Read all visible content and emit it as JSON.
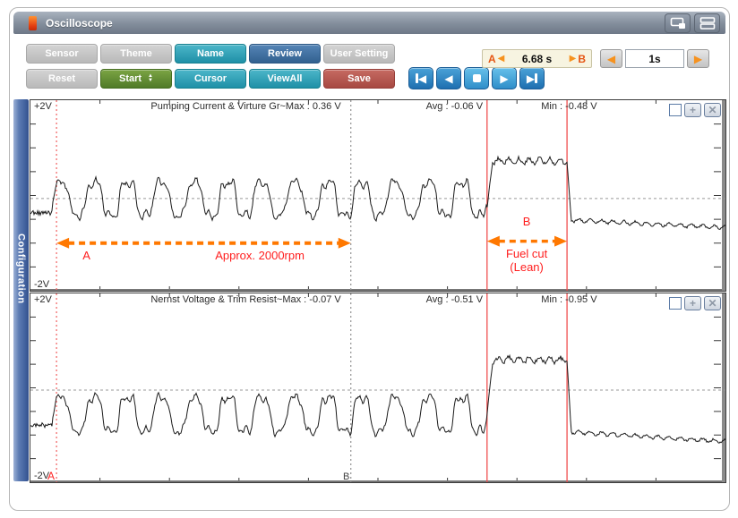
{
  "window": {
    "title": "Oscilloscope",
    "controls": [
      "cascade",
      "tile"
    ]
  },
  "toolbar": {
    "row1": [
      {
        "label": "Sensor"
      },
      {
        "label": "Theme"
      },
      {
        "label": "Name"
      },
      {
        "label": "Review"
      },
      {
        "label": "User Setting"
      }
    ],
    "row2": [
      {
        "label": "Reset"
      },
      {
        "label": "Start"
      },
      {
        "label": "Cursor"
      },
      {
        "label": "ViewAll"
      },
      {
        "label": "Save"
      }
    ],
    "ab_range": {
      "a": "A",
      "value": "6.68 s",
      "b": "B"
    },
    "timebase": {
      "value": "1s"
    },
    "transport": [
      "skip-start",
      "step-back",
      "stop",
      "play",
      "skip-end"
    ]
  },
  "sidebar": {
    "label": "Configuration"
  },
  "cursors": {
    "a_frac": 0.0375,
    "b_frac": 0.461,
    "r1_frac": 0.657,
    "r2_frac": 0.772,
    "a_label": "A",
    "b_label": "B"
  },
  "charts": [
    {
      "v_top": "+2V",
      "v_bottom": "-2V",
      "title": "Pumping Current & Virture Gr~Max : 0.36 V",
      "avg": "Avg : -0.06 V",
      "min": "Min : -0.48 V",
      "annotations": {
        "a": "A",
        "rpm": "Approx. 2000rpm",
        "b": "B",
        "fuel_line1": "Fuel cut",
        "fuel_line2": "(Lean)"
      },
      "wave": {
        "center": 0.516,
        "osc_start": 0.032,
        "osc_top": -0.082,
        "osc_bottom": 0.088,
        "cycles": 13,
        "plateau": -0.197,
        "tail_start": 0.112,
        "tail_end": 0.152
      },
      "arrows": [
        {
          "x1": 0.0375,
          "x2": 0.461,
          "y": 0.75,
          "w": 4
        },
        {
          "x1": 0.657,
          "x2": 0.772,
          "y": 0.74,
          "w": 3.5
        }
      ]
    },
    {
      "v_top": "+2V",
      "v_bottom": "-2V",
      "title": "Nernst Voltage & Trim Resist~Max : -0.07 V",
      "avg": "Avg : -0.51 V",
      "min": "Min : -0.95 V",
      "wave": {
        "center": 0.512,
        "osc_start": 0.032,
        "osc_top": 0.042,
        "osc_bottom": 0.218,
        "cycles": 13,
        "plateau": -0.161,
        "tail_start": 0.22,
        "tail_end": 0.272
      }
    }
  ],
  "colors": {
    "annotation_red": "#ff1e1e",
    "arrow_orange": "#ff7800",
    "cursor_red_dashed": "#f26b6b",
    "cursor_gray_dashed": "#9a9a9a",
    "cursor_red_solid": "#f05050",
    "trace": "#1a1a1a",
    "midline": "#999999"
  }
}
